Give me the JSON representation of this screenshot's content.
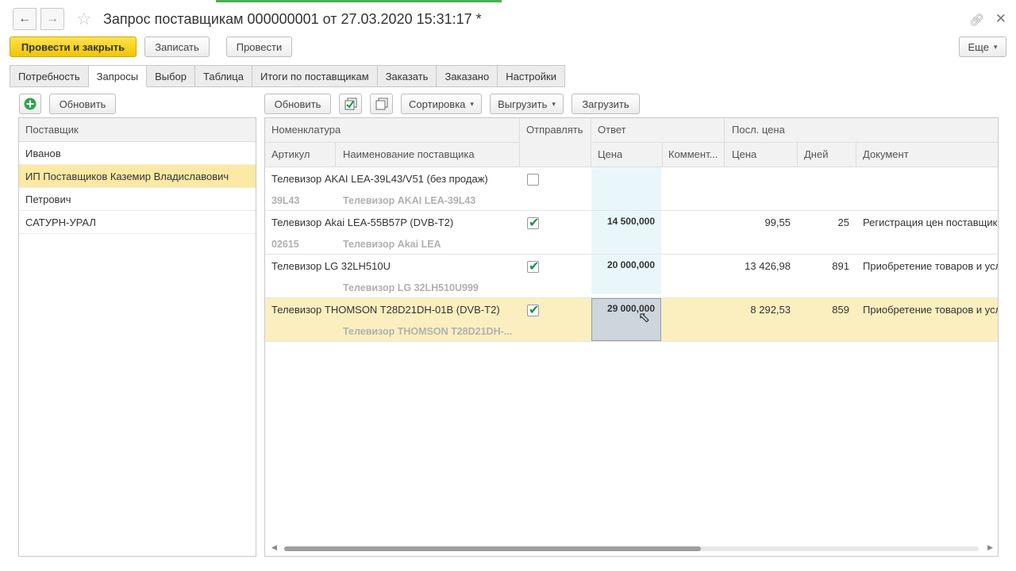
{
  "window": {
    "title": "Запрос поставщикам 000000001 от 27.03.2020 15:31:17 *"
  },
  "toolbar": {
    "post_close": "Провести и закрыть",
    "save": "Записать",
    "post": "Провести",
    "more": "Еще"
  },
  "tabs": [
    "Потребность",
    "Запросы",
    "Выбор",
    "Таблица",
    "Итоги по поставщикам",
    "Заказать",
    "Заказано",
    "Настройки"
  ],
  "active_tab": "Запросы",
  "left": {
    "refresh": "Обновить",
    "header": "Поставщик",
    "suppliers": [
      "Иванов",
      "ИП Поставщиков Каземир Владиславович",
      "Петрович",
      "САТУРН-УРАЛ"
    ],
    "selected_supplier": "ИП Поставщиков Каземир Владиславович"
  },
  "right": {
    "refresh": "Обновить",
    "sort": "Сортировка",
    "export": "Выгрузить",
    "import": "Загрузить",
    "headers": {
      "nomenclature": "Номенклатура",
      "send": "Отправлять",
      "answer": "Ответ",
      "last_price": "Посл. цена",
      "article": "Артикул",
      "supplier_name": "Наименование поставщика",
      "price": "Цена",
      "comment": "Коммент...",
      "last_price_value": "Цена",
      "days": "Дней",
      "document": "Документ"
    },
    "rows": [
      {
        "name": "Телевизор AKAI LEA-39L43/V51 (без продаж)",
        "article": "39L43",
        "supplier_name": "Телевизор AKAI LEA-39L43",
        "send": false,
        "price": "",
        "last_price": "",
        "days": "",
        "document": ""
      },
      {
        "name": "Телевизор Akai LEA-55B57P (DVB-T2)",
        "article": "02615",
        "supplier_name": "Телевизор Akai LEA",
        "send": true,
        "price": "14 500,000",
        "last_price": "99,55",
        "days": "25",
        "document": "Регистрация цен поставщика"
      },
      {
        "name": "Телевизор LG 32LH510U",
        "article": "",
        "supplier_name": "Телевизор LG 32LH510U999",
        "send": true,
        "price": "20 000,000",
        "last_price": "13 426,98",
        "days": "891",
        "document": "Приобретение товаров и услуг"
      },
      {
        "name": "Телевизор THOMSON T28D21DH-01B (DVB-T2)",
        "article": "",
        "supplier_name": "Телевизор THOMSON T28D21DH-...",
        "send": true,
        "price": "29 000,000",
        "last_price": "8 292,53",
        "days": "859",
        "document": "Приобретение товаров и услуг"
      }
    ],
    "selected_row": 3,
    "scroll_position": 0.6
  },
  "icons": [
    "back-arrow-icon",
    "forward-arrow-icon",
    "star-icon",
    "link-icon",
    "close-icon",
    "add-icon",
    "check-all-icon",
    "uncheck-all-icon",
    "mouse-cursor-icon"
  ],
  "colors": {
    "accent_yellow": "#f2c500",
    "selected_row": "#fbefc0",
    "check_green": "#1f8f4e"
  }
}
